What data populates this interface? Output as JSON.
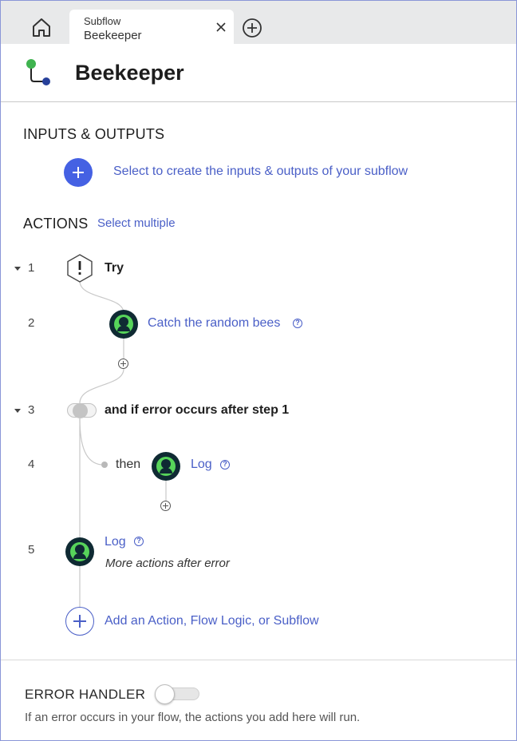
{
  "tabs": {
    "home_icon": "home-icon",
    "active": {
      "kind": "Subflow",
      "name": "Beekeeper",
      "close_icon": "close-icon"
    },
    "add_icon": "add-tab-icon"
  },
  "header": {
    "title": "Beekeeper",
    "icon": "subflow-icon"
  },
  "inputs_outputs": {
    "heading": "INPUTS & OUTPUTS",
    "create_link": "Select to create the inputs & outputs of your subflow"
  },
  "actions": {
    "heading": "ACTIONS",
    "select_multiple": "Select multiple",
    "steps": [
      {
        "number": "1",
        "label": "Try"
      },
      {
        "number": "2",
        "label": "Catch the random bees"
      },
      {
        "number": "3",
        "label": "and if error occurs after step 1"
      },
      {
        "number": "4",
        "prefix": "then",
        "label": "Log"
      },
      {
        "number": "5",
        "label": "Log",
        "sublabel": "More actions after error"
      }
    ],
    "add_link": "Add an Action, Flow Logic, or Subflow"
  },
  "error_handler": {
    "heading": "ERROR HANDLER",
    "enabled": false,
    "description": "If an error occurs in your flow, the actions you add here will run."
  },
  "colors": {
    "accent_blue": "#4561e3",
    "link_blue": "#4a5fc7",
    "action_green": "#57d45a",
    "action_dark": "#0f2a33",
    "frame_border": "#8a96d8"
  }
}
